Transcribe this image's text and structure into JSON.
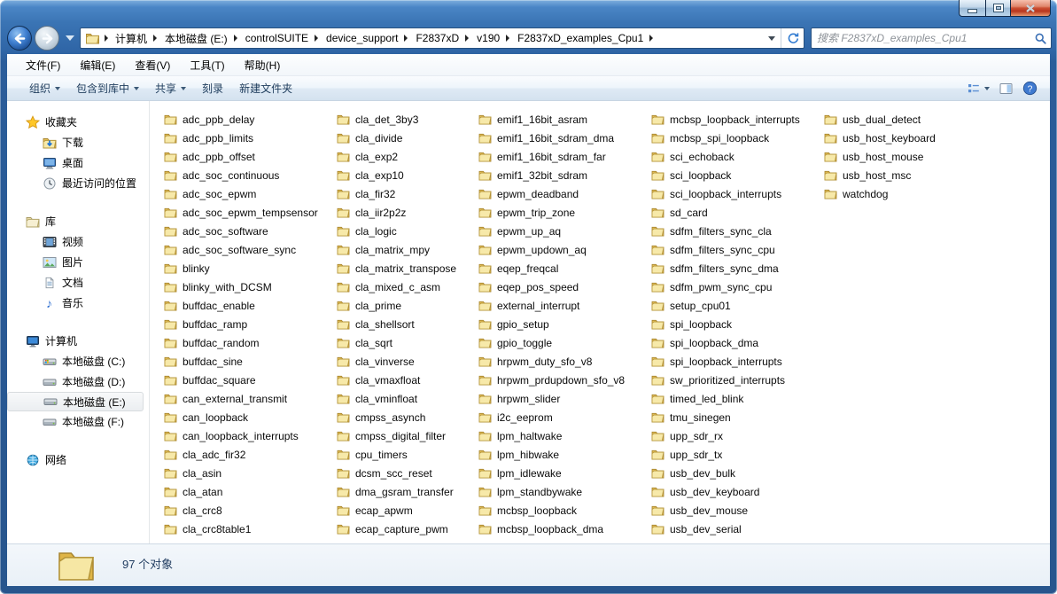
{
  "navigation": {
    "breadcrumbs": [
      "计算机",
      "本地磁盘 (E:)",
      "controlSUITE",
      "device_support",
      "F2837xD",
      "v190",
      "F2837xD_examples_Cpu1"
    ]
  },
  "search": {
    "placeholder": "搜索 F2837xD_examples_Cpu1"
  },
  "menu": {
    "items": [
      "文件(F)",
      "编辑(E)",
      "查看(V)",
      "工具(T)",
      "帮助(H)"
    ]
  },
  "toolbar": {
    "organize": "组织",
    "include_in_library": "包含到库中",
    "share": "共享",
    "burn": "刻录",
    "new_folder": "新建文件夹"
  },
  "sidebar": {
    "favorites": {
      "label": "收藏夹",
      "items": [
        "下载",
        "桌面",
        "最近访问的位置"
      ]
    },
    "libraries": {
      "label": "库",
      "items": [
        "视频",
        "图片",
        "文档",
        "音乐"
      ]
    },
    "computer": {
      "label": "计算机",
      "items": [
        "本地磁盘 (C:)",
        "本地磁盘 (D:)",
        "本地磁盘 (E:)",
        "本地磁盘 (F:)"
      ],
      "selected": "本地磁盘 (E:)"
    },
    "network": {
      "label": "网络"
    }
  },
  "files": {
    "columns": [
      [
        "adc_ppb_delay",
        "adc_ppb_limits",
        "adc_ppb_offset",
        "adc_soc_continuous",
        "adc_soc_epwm",
        "adc_soc_epwm_tempsensor",
        "adc_soc_software",
        "adc_soc_software_sync",
        "blinky",
        "blinky_with_DCSM",
        "buffdac_enable",
        "buffdac_ramp",
        "buffdac_random",
        "buffdac_sine",
        "buffdac_square",
        "can_external_transmit",
        "can_loopback",
        "can_loopback_interrupts",
        "cla_adc_fir32",
        "cla_asin",
        "cla_atan",
        "cla_crc8",
        "cla_crc8table1"
      ],
      [
        "cla_det_3by3",
        "cla_divide",
        "cla_exp2",
        "cla_exp10",
        "cla_fir32",
        "cla_iir2p2z",
        "cla_logic",
        "cla_matrix_mpy",
        "cla_matrix_transpose",
        "cla_mixed_c_asm",
        "cla_prime",
        "cla_shellsort",
        "cla_sqrt",
        "cla_vinverse",
        "cla_vmaxfloat",
        "cla_vminfloat",
        "cmpss_asynch",
        "cmpss_digital_filter",
        "cpu_timers",
        "dcsm_scc_reset",
        "dma_gsram_transfer",
        "ecap_apwm",
        "ecap_capture_pwm"
      ],
      [
        "emif1_16bit_asram",
        "emif1_16bit_sdram_dma",
        "emif1_16bit_sdram_far",
        "emif1_32bit_sdram",
        "epwm_deadband",
        "epwm_trip_zone",
        "epwm_up_aq",
        "epwm_updown_aq",
        "eqep_freqcal",
        "eqep_pos_speed",
        "external_interrupt",
        "gpio_setup",
        "gpio_toggle",
        "hrpwm_duty_sfo_v8",
        "hrpwm_prdupdown_sfo_v8",
        "hrpwm_slider",
        "i2c_eeprom",
        "lpm_haltwake",
        "lpm_hibwake",
        "lpm_idlewake",
        "lpm_standbywake",
        "mcbsp_loopback",
        "mcbsp_loopback_dma"
      ],
      [
        "mcbsp_loopback_interrupts",
        "mcbsp_spi_loopback",
        "sci_echoback",
        "sci_loopback",
        "sci_loopback_interrupts",
        "sd_card",
        "sdfm_filters_sync_cla",
        "sdfm_filters_sync_cpu",
        "sdfm_filters_sync_dma",
        "sdfm_pwm_sync_cpu",
        "setup_cpu01",
        "spi_loopback",
        "spi_loopback_dma",
        "spi_loopback_interrupts",
        "sw_prioritized_interrupts",
        "timed_led_blink",
        "tmu_sinegen",
        "upp_sdr_rx",
        "upp_sdr_tx",
        "usb_dev_bulk",
        "usb_dev_keyboard",
        "usb_dev_mouse",
        "usb_dev_serial"
      ],
      [
        "usb_dual_detect",
        "usb_host_keyboard",
        "usb_host_mouse",
        "usb_host_msc",
        "watchdog"
      ]
    ]
  },
  "status_bar": {
    "item_count": "97 个对象"
  }
}
